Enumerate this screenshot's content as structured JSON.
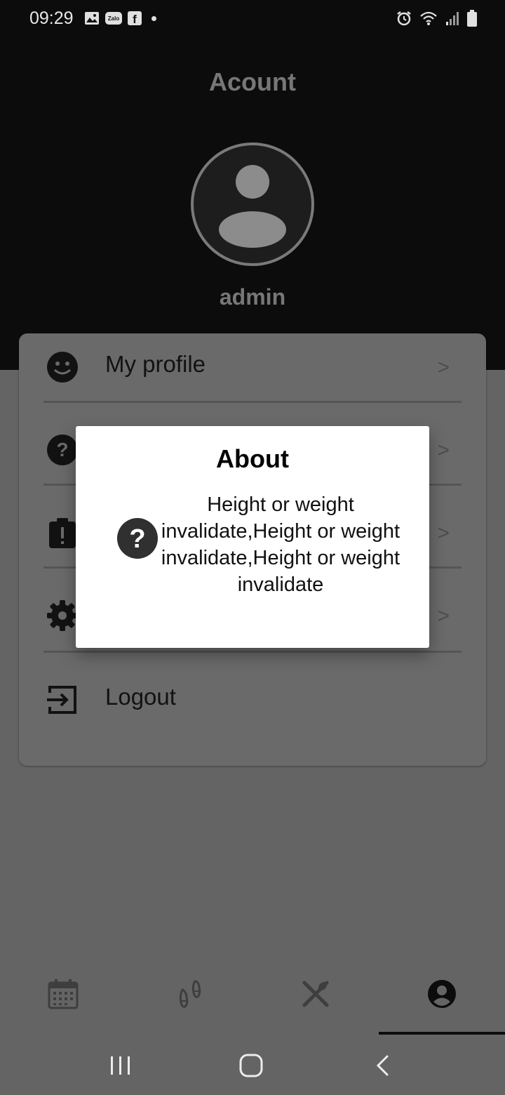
{
  "status_bar": {
    "time": "09:29",
    "left_icons": [
      "gallery-icon",
      "zalo-icon",
      "facebook-icon",
      "dot-icon"
    ],
    "right_icons": [
      "alarm-icon",
      "wifi-icon",
      "signal-icon",
      "battery-icon"
    ],
    "zalo_label": "Zalo",
    "facebook_label": "f"
  },
  "header": {
    "title": "Acount",
    "username": "admin"
  },
  "menu": {
    "items": [
      {
        "label": "My profile",
        "arrow": ">",
        "icon": "smiley-icon"
      },
      {
        "label": "",
        "arrow": ">",
        "icon": "help-icon"
      },
      {
        "label": "",
        "arrow": ">",
        "icon": "clipboard-alert-icon"
      },
      {
        "label": "",
        "arrow": ">",
        "icon": "gear-icon"
      },
      {
        "label": "Logout",
        "icon": "logout-icon"
      }
    ]
  },
  "dialog": {
    "title": "About",
    "message": "Height or weight invalidate,Height or weight invalidate,Height or weight invalidate",
    "icon": "help-icon"
  },
  "bottom_nav": {
    "items": [
      {
        "icon": "calendar-icon"
      },
      {
        "icon": "footsteps-icon"
      },
      {
        "icon": "utensils-icon"
      },
      {
        "icon": "account-icon"
      }
    ],
    "selected_index": 3
  },
  "system_nav": {
    "buttons": [
      "recents-icon",
      "home-icon",
      "back-icon"
    ]
  },
  "colors": {
    "header_background": "#0c0c0c",
    "scrim_background": "#646464",
    "dialog_background": "#ffffff"
  }
}
